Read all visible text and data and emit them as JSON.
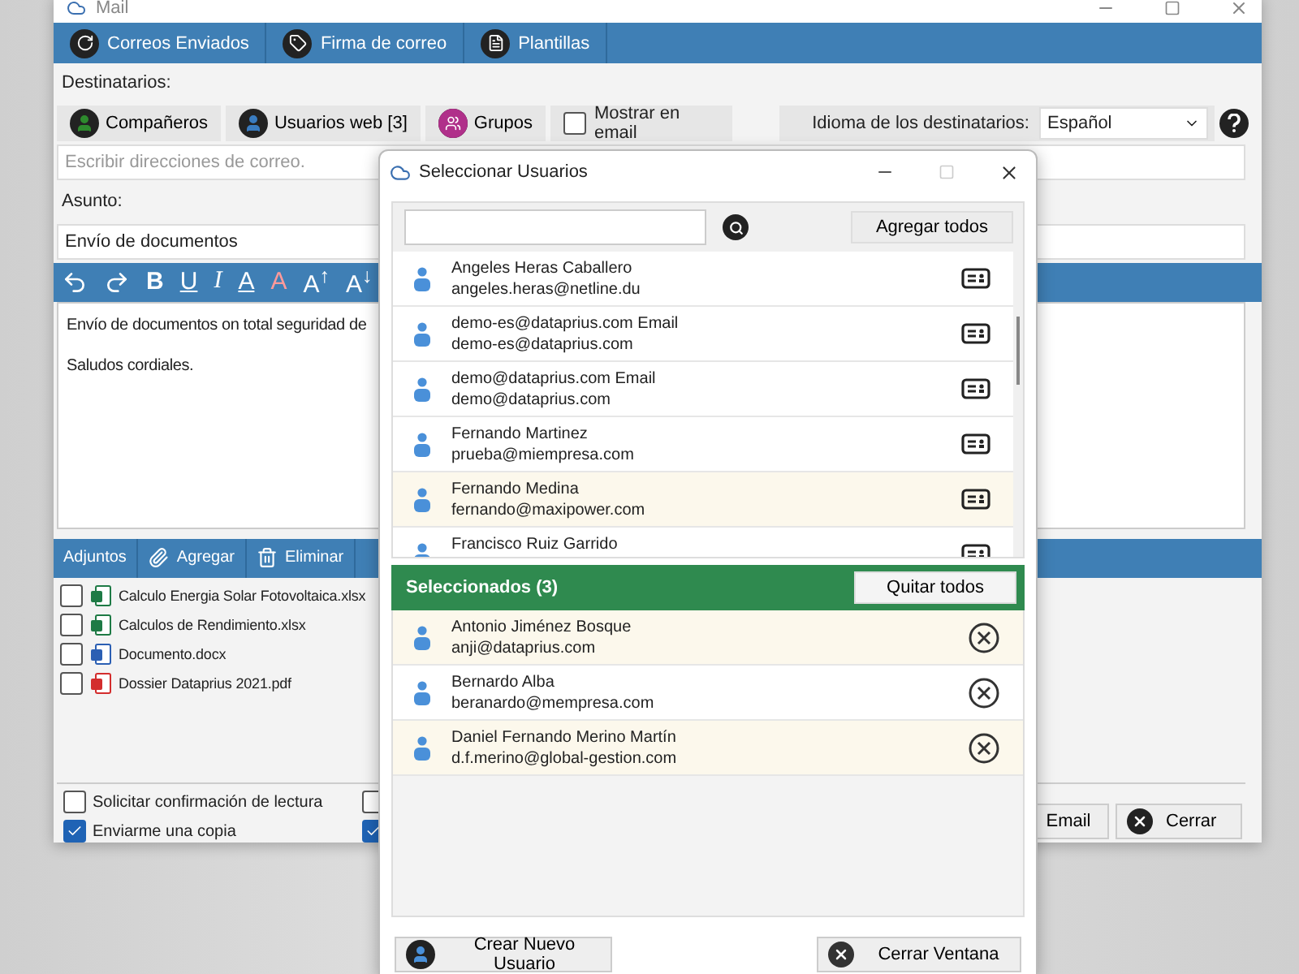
{
  "window": {
    "title": "Mail"
  },
  "toolbar": [
    {
      "kind": "sent",
      "label": "Correos Enviados"
    },
    {
      "kind": "signature",
      "label": "Firma de correo"
    },
    {
      "kind": "templates",
      "label": "Plantillas"
    }
  ],
  "recipients_label": "Destinatarios:",
  "recipient_sources": [
    {
      "kind": "colleagues",
      "label": "Compañeros"
    },
    {
      "kind": "web",
      "label": "Usuarios web [3]"
    },
    {
      "kind": "groups",
      "label": "Grupos"
    }
  ],
  "show_in_email": {
    "label": "Mostrar en email",
    "checked": false
  },
  "language": {
    "label": "Idioma de los destinatarios:",
    "value": "Español"
  },
  "address_field": {
    "placeholder": "Escribir direcciones de correo."
  },
  "subject_label": "Asunto:",
  "subject_field": {
    "value": "Envío de documentos"
  },
  "editor_tools": [
    {
      "kind": "undo"
    },
    {
      "kind": "redo"
    },
    {
      "kind": "bold",
      "label": "B"
    },
    {
      "kind": "underline",
      "label": "U"
    },
    {
      "kind": "italic",
      "label": "I"
    },
    {
      "kind": "color",
      "label": "A"
    },
    {
      "kind": "highlight",
      "label": "A"
    },
    {
      "kind": "grow",
      "label": "A$^{↑}$"
    },
    {
      "kind": "shrink",
      "label": "A$^{↓}$"
    }
  ],
  "body": [
    "Envío de documentos on total seguridad de",
    "Saludos cordiales."
  ],
  "attachments": {
    "title": "Adjuntos",
    "actions": [
      {
        "kind": "add",
        "label": "Agregar"
      },
      {
        "kind": "delete",
        "label": "Eliminar"
      }
    ],
    "files": [
      {
        "kind": "excel",
        "name": "Calculo Energia Solar Fotovoltaica.xlsx",
        "checked": false
      },
      {
        "kind": "excel",
        "name": "Calculos de Rendimiento.xlsx",
        "checked": false
      },
      {
        "kind": "word",
        "name": "Documento.docx",
        "checked": false
      },
      {
        "kind": "pdf",
        "name": "Dossier Dataprius 2021.pdf",
        "checked": false
      }
    ]
  },
  "options": [
    {
      "label": "Solicitar confirmación de lectura",
      "checked": false
    },
    {
      "label": "Enviarme una copia",
      "checked": true
    }
  ],
  "options_right": [
    {
      "checked": false
    },
    {
      "checked": true
    }
  ],
  "buttons": [
    {
      "kind": "send",
      "label": "Email"
    },
    {
      "kind": "close",
      "label": "Cerrar"
    }
  ],
  "dialog": {
    "title": "Seleccionar Usuarios",
    "add_all": "Agregar todos",
    "users": [
      {
        "name": "Angeles Heras Caballero",
        "email": "angeles.heras@netline.du",
        "highlighted": false
      },
      {
        "name": "demo-es@dataprius.com Email",
        "email": "demo-es@dataprius.com",
        "highlighted": false
      },
      {
        "name": "demo@dataprius.com Email",
        "email": "demo@dataprius.com",
        "highlighted": false
      },
      {
        "name": "Fernando Martinez",
        "email": "prueba@miempresa.com",
        "highlighted": false
      },
      {
        "name": "Fernando Medina",
        "email": "fernando@maxipower.com",
        "highlighted": true
      },
      {
        "name": "Francisco Ruiz Garrido",
        "highlighted": false
      }
    ],
    "selected_title": "Seleccionados (3)",
    "remove_all": "Quitar todos",
    "selected": [
      {
        "name": "Antonio Jiménez Bosque",
        "email": "anji@dataprius.com",
        "highlighted": true
      },
      {
        "name": "Bernardo Alba",
        "email": "beranardo@mempresa.com",
        "highlighted": false
      },
      {
        "name": "Daniel Fernando Merino Martín",
        "email": "d.f.merino@global-gestion.com",
        "highlighted": true
      }
    ],
    "footer_buttons": [
      {
        "kind": "new_user",
        "label": "Crear Nuevo Usuario"
      },
      {
        "kind": "close",
        "label": "Cerrar Ventana"
      }
    ]
  }
}
